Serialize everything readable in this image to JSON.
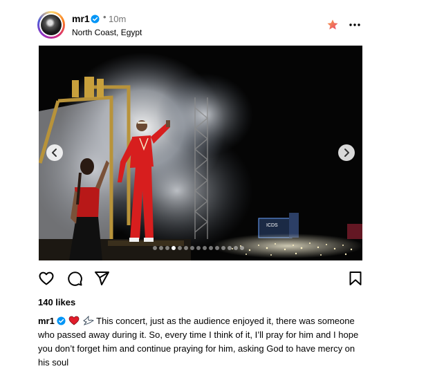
{
  "post": {
    "username": "mr1",
    "time_dot": "•",
    "time_ago": "10m",
    "location": "North Coast, Egypt",
    "likes": "140 likes",
    "caption_text": "This concert, just as the audience enjoyed it, there was someone who passed away during it. So, every time I think of it, I’ll pray for him and I hope you don’t forget him and continue praying for him, asking God to have mercy on his soul",
    "caption_emojis": [
      "heart-icon",
      "dove-icon"
    ]
  },
  "media": {
    "stage_sign": "ICDS",
    "carousel": {
      "total_slides": 15,
      "current_index": 3
    }
  },
  "icons": {
    "verified": "verified-badge-icon",
    "favorite": "star-icon",
    "more": "more-options-icon",
    "like": "heart-outline-icon",
    "comment": "comment-icon",
    "share": "paper-plane-icon",
    "save": "bookmark-icon"
  },
  "colors": {
    "verified": "#0095f6",
    "star": "#f26b6b",
    "muted": "#737373",
    "heart": "#e11d2b"
  }
}
